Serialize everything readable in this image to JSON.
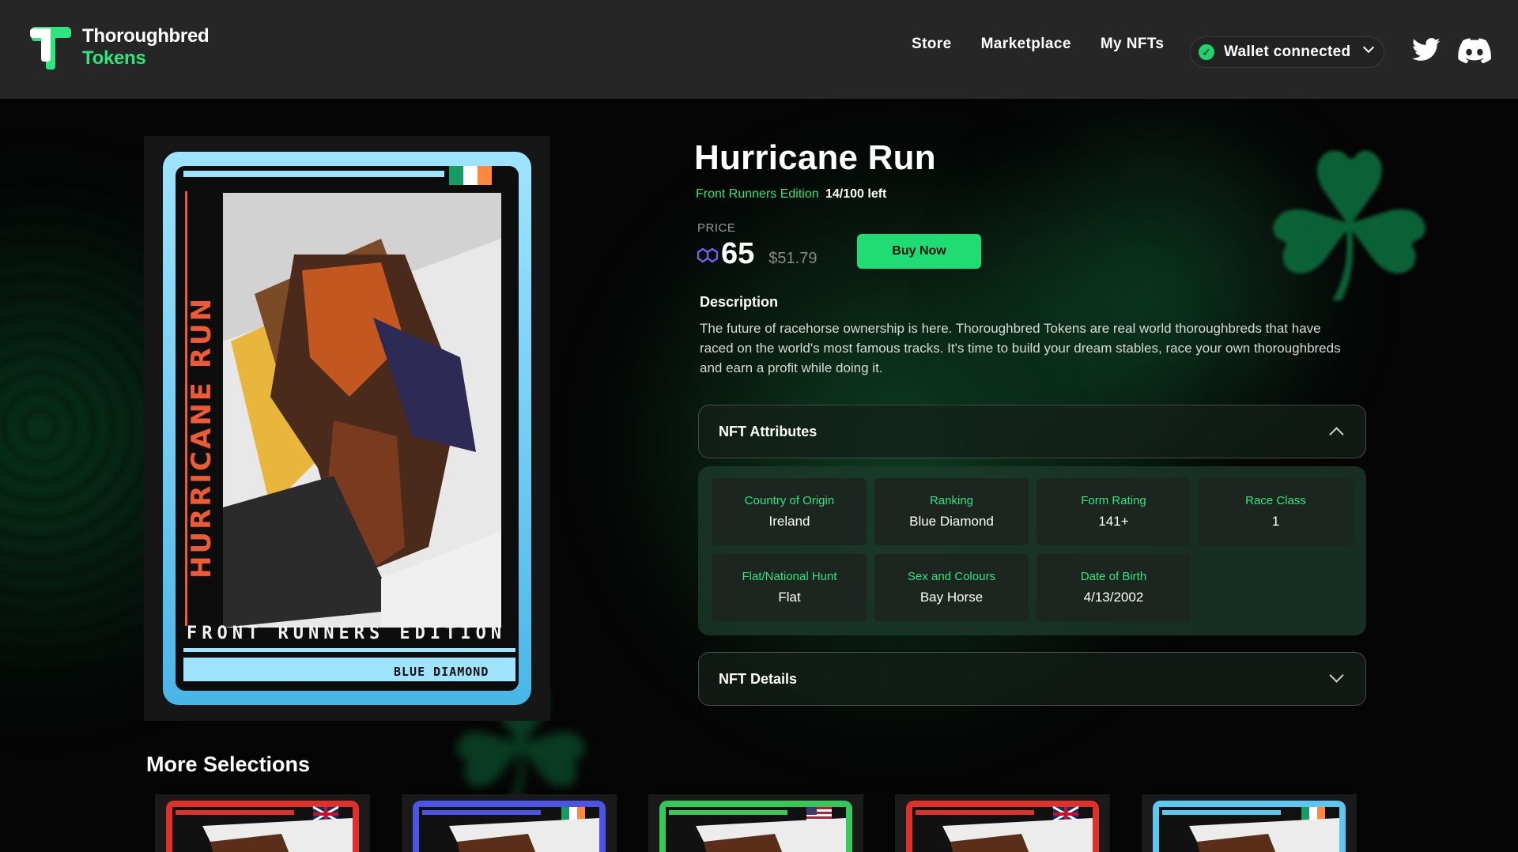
{
  "header": {
    "brand_line1": "Thoroughbred",
    "brand_line2": "Tokens",
    "nav": [
      "Store",
      "Marketplace",
      "My NFTs"
    ],
    "wallet_label": "Wallet connected",
    "icons": [
      "twitter-icon",
      "discord-icon"
    ]
  },
  "nft": {
    "title": "Hurricane Run",
    "edition": "Front Runners Edition",
    "remaining": "14/100 left",
    "price_label": "PRICE",
    "price_value": "65",
    "price_usd": "$51.79",
    "buy_label": "Buy Now",
    "description_heading": "Description",
    "description": "The future of racehorse ownership is here. Thoroughbred Tokens are real world thoroughbreds that have raced on the world's most famous tracks. It's time to build your dream stables, race your own thoroughbreds and earn a profit while doing it.",
    "card_art": {
      "vertical_text": "HURRICANE RUN",
      "edition_text": "FRONT RUNNERS EDITION",
      "rank_text": "BLUE DIAMOND"
    }
  },
  "attributes_section": {
    "label": "NFT Attributes",
    "items": [
      {
        "key": "Country of Origin",
        "value": "Ireland"
      },
      {
        "key": "Ranking",
        "value": "Blue Diamond"
      },
      {
        "key": "Form Rating",
        "value": "141+"
      },
      {
        "key": "Race Class",
        "value": "1"
      },
      {
        "key": "Flat/National Hunt",
        "value": "Flat"
      },
      {
        "key": "Sex and Colours",
        "value": "Bay Horse"
      },
      {
        "key": "Date of Birth",
        "value": "4/13/2002"
      }
    ]
  },
  "details_section": {
    "label": "NFT Details"
  },
  "more": {
    "heading": "More Selections",
    "thumbs": [
      {
        "frame": "#e0302a",
        "flag": "uk"
      },
      {
        "frame": "#4a55e8",
        "flag": "ie"
      },
      {
        "frame": "#37c85a",
        "flag": "us"
      },
      {
        "frame": "#e0302a",
        "flag": "uk"
      },
      {
        "frame": "#5ac8f0",
        "flag": "ie"
      }
    ]
  },
  "colors": {
    "accent": "#2ee57e",
    "button": "#1fdc74",
    "header_bg": "#262626",
    "page_bg": "#050505"
  }
}
